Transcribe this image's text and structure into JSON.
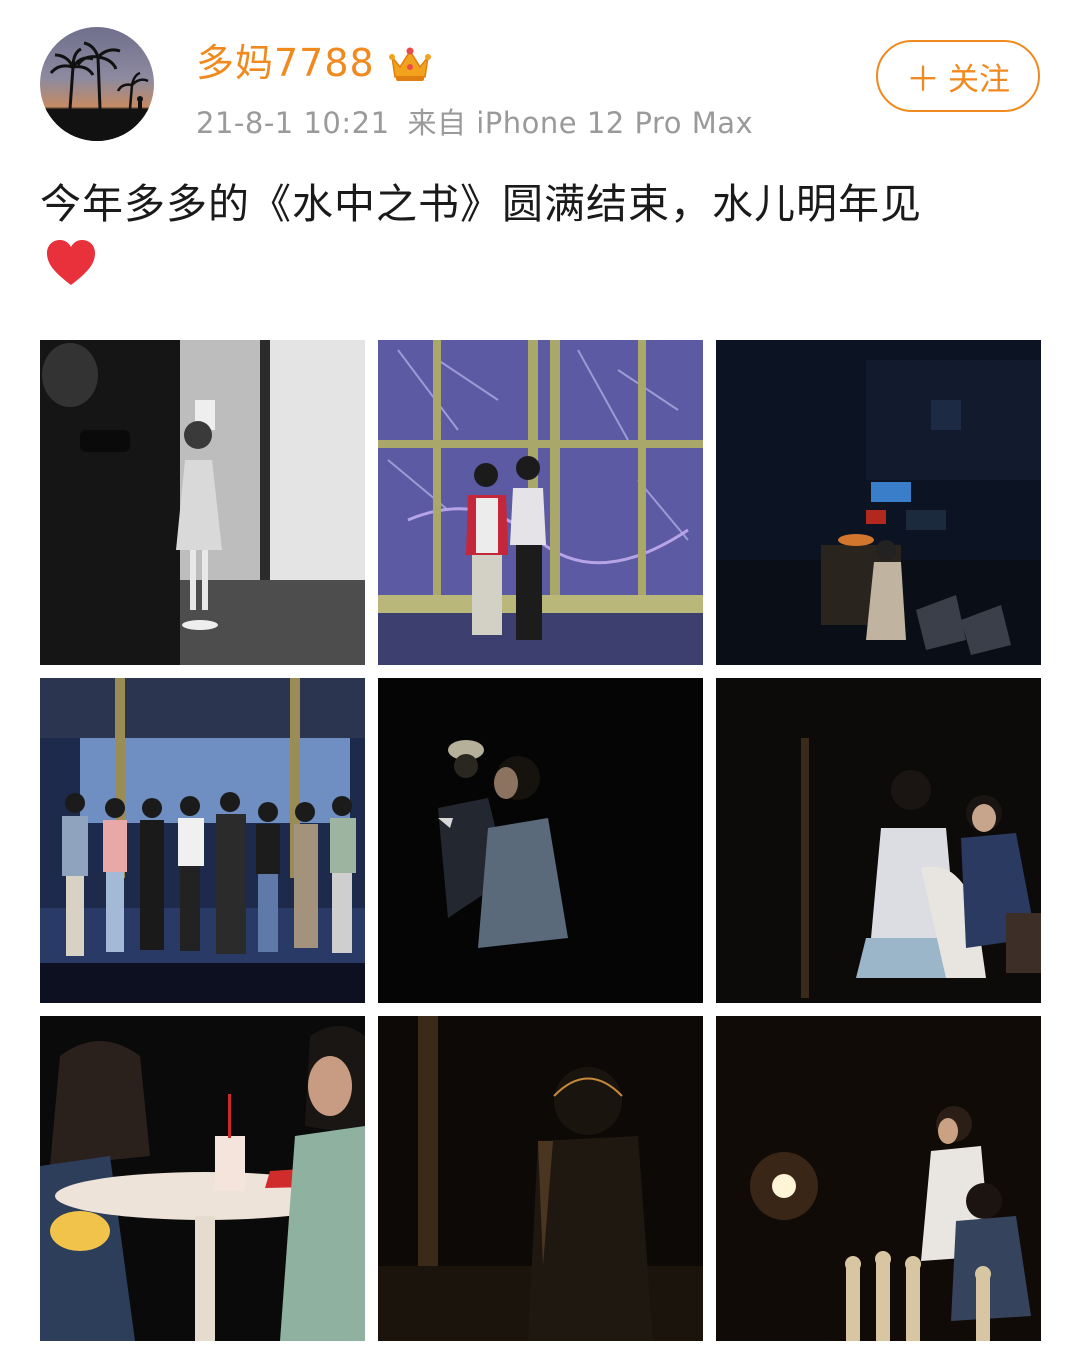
{
  "post": {
    "author": {
      "name": "多妈7788",
      "verified_badge": "crown-icon"
    },
    "timestamp": "21-8-1 10:21",
    "source": "来自 iPhone 12 Pro Max",
    "follow_label": "关注",
    "follow_icon": "plus-icon",
    "text": "今年多多的《水中之书》圆满结束，水儿明年见",
    "emoji": "heart-icon",
    "accent_color": "#f08a1f",
    "photos": [
      {
        "id": 1,
        "subject": "backstage-black-white-photo"
      },
      {
        "id": 2,
        "subject": "couple-in-front-of-window-set"
      },
      {
        "id": 3,
        "subject": "dark-backstage-girl-seated"
      },
      {
        "id": 4,
        "subject": "cast-group-on-stage"
      },
      {
        "id": 5,
        "subject": "dark-stage-two-actors"
      },
      {
        "id": 6,
        "subject": "girl-on-carousel-horse-with-man"
      },
      {
        "id": 7,
        "subject": "two-girls-at-table"
      },
      {
        "id": 8,
        "subject": "silhouette-in-dark"
      },
      {
        "id": 9,
        "subject": "girl-on-carousel-stage-light"
      }
    ]
  }
}
